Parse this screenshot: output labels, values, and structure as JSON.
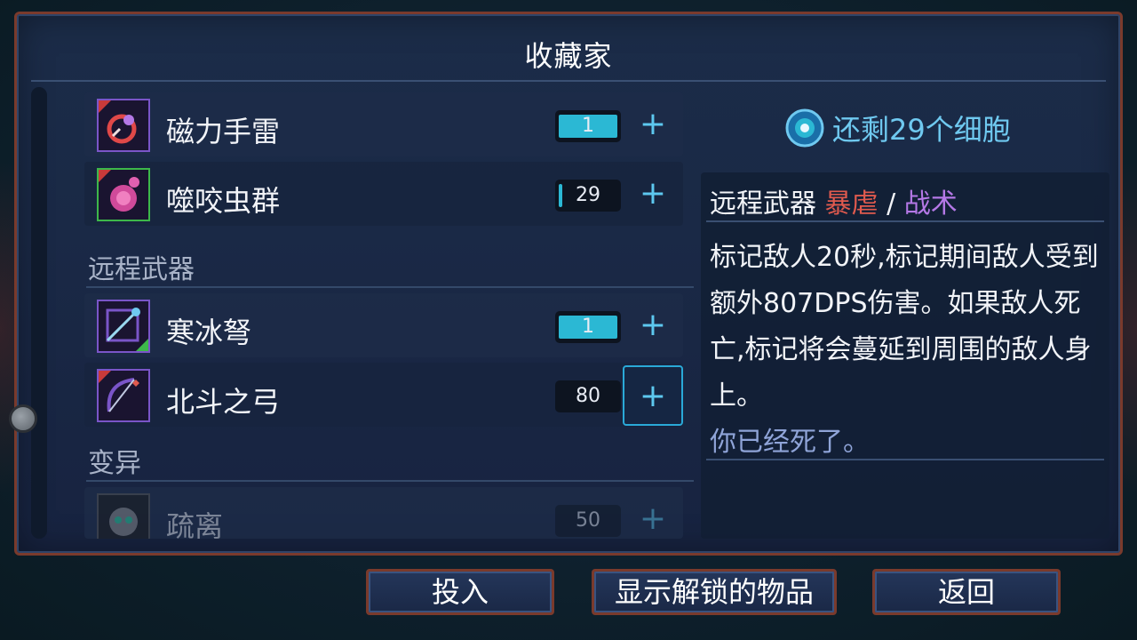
{
  "title": "收藏家",
  "items": [
    {
      "name": "磁力手雷",
      "count": "1",
      "fill": 1.0
    },
    {
      "name": "噬咬虫群",
      "count": "29",
      "fill": 0.05
    },
    {
      "name": "寒冰弩",
      "count": "1",
      "fill": 1.0
    },
    {
      "name": "北斗之弓",
      "count": "80",
      "fill": 0.0
    },
    {
      "name": "疏离",
      "count": "50",
      "fill": 0.0
    }
  ],
  "plus_label": "+",
  "sections": {
    "ranged": "远程武器",
    "mutation": "变异"
  },
  "cells_remaining": "还剩29个细胞",
  "detail": {
    "category": "远程武器",
    "tag_brutality": "暴虐",
    "separator": "/",
    "tag_tactics": "战术",
    "description": "标记敌人20秒,标记期间敌人受到额外807DPS伤害。如果敌人死亡,标记将会蔓延到周围的敌人身上。",
    "flavor": "你已经死了。"
  },
  "buttons": {
    "invest": "投入",
    "show_unlocked": "显示解锁的物品",
    "back": "返回"
  },
  "colors": {
    "accent_cyan": "#2bb8d4",
    "brutality_red": "#e05a4e",
    "tactics_purple": "#b478e6",
    "frame_rust": "#7a3a2c"
  }
}
